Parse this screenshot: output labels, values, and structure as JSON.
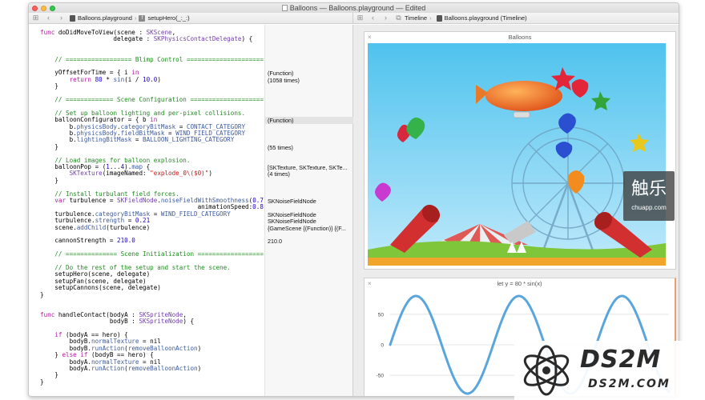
{
  "window": {
    "title": "Balloons — Balloons.playground — Edited"
  },
  "jumpbar_left": {
    "file": "Balloons.playground",
    "function": "setupHero(_:_:)"
  },
  "jumpbar_right": {
    "timeline": "Timeline",
    "file": "Balloons.playground (Timeline)"
  },
  "code_lines": [
    "func doDidMoveToView(scene : SKScene,",
    "                    delegate : SKPhysicsContactDelegate) {",
    "",
    "",
    "    // ================== Blimp Control =====================",
    "",
    "    yOffsetForTime = { i in",
    "        return 80 * sin(i / 10.0)",
    "    }",
    "",
    "    // ============= Scene Configuration ====================",
    "",
    "    // Set up balloon lighting and per-pixel collisions.",
    "    balloonConfigurator = { b in",
    "        b.physicsBody.categoryBitMask = CONTACT_CATEGORY",
    "        b.physicsBody.fieldBitMask = WIND_FIELD_CATEGORY",
    "        b.lightingBitMask = BALLOON_LIGHTING_CATEGORY",
    "    }",
    "",
    "    // Load images for balloon explosion.",
    "    balloonPop = (1...4).map {",
    "        SKTexture(imageNamed: \"explode_0\\($0)\")",
    "    }",
    "",
    "    // Install turbulant field forces.",
    "    var turbulence = SKFieldNode.noiseFieldWithSmoothness(0.7,",
    "                                           animationSpeed:0.8)",
    "    turbulence.categoryBitMask = WIND_FIELD_CATEGORY",
    "    turbulence.strength = 0.21",
    "    scene.addChild(turbulence)",
    "",
    "    cannonStrength = 210.0",
    "",
    "    // ============== Scene Initialization ==================",
    "",
    "    // Do the rest of the setup and start the scene.",
    "    setupHero(scene, delegate)",
    "    setupFan(scene, delegate)",
    "    setupCannons(scene, delegate)",
    "}",
    "",
    "",
    "func handleContact(bodyA : SKSpriteNode,",
    "                   bodyB : SKSpriteNode) {",
    "",
    "    if (bodyA == hero) {",
    "        bodyB.normalTexture = nil",
    "        bodyB.runAction(removeBalloonAction)",
    "    } else if (bodyB == hero) {",
    "        bodyA.normalTexture = nil",
    "        bodyA.runAction(removeBalloonAction)",
    "    }",
    "}"
  ],
  "results": [
    {
      "line": 6,
      "text": "(Function)"
    },
    {
      "line": 7,
      "text": "(1058 times)"
    },
    {
      "line": 13,
      "text": "(Function)",
      "highlight": true
    },
    {
      "line": 17,
      "text": "(55 times)"
    },
    {
      "line": 20,
      "text": "[SKTexture, SKTexture, SKTe..."
    },
    {
      "line": 21,
      "text": "(4 times)"
    },
    {
      "line": 25,
      "text": "SKNoiseFieldNode"
    },
    {
      "line": 27,
      "text": "SKNoiseFieldNode"
    },
    {
      "line": 28,
      "text": "SKNoiseFieldNode"
    },
    {
      "line": 29,
      "text": "{GameScene {(Function)} {(F..."
    },
    {
      "line": 31,
      "text": "210.0"
    }
  ],
  "scene_panel": {
    "title": "Balloons",
    "close": "×"
  },
  "graph_panel": {
    "title": "let y = 80 * sin(x)",
    "close": "×"
  },
  "chart_data": {
    "type": "line",
    "title": "let y = 80 * sin(x)",
    "function": "y = 80 * sin(x / 10)",
    "x_range": [
      0,
      170
    ],
    "ylim": [
      -80,
      80
    ],
    "ytick_labels": [
      "50",
      "0",
      "-50"
    ],
    "ytick_values": [
      50,
      0,
      -50
    ],
    "series_color": "#5aa6dc"
  },
  "watermarks": {
    "chuapp_big": "触乐",
    "chuapp_small": "chuapp.com",
    "ds2m_big": "DS2M",
    "ds2m_small": "DS2M.COM"
  },
  "colors": {
    "keyword": "#b3199e",
    "comment": "#1f8c1f",
    "type": "#6f3fa9",
    "string": "#c41a16",
    "number": "#1c00cf"
  }
}
